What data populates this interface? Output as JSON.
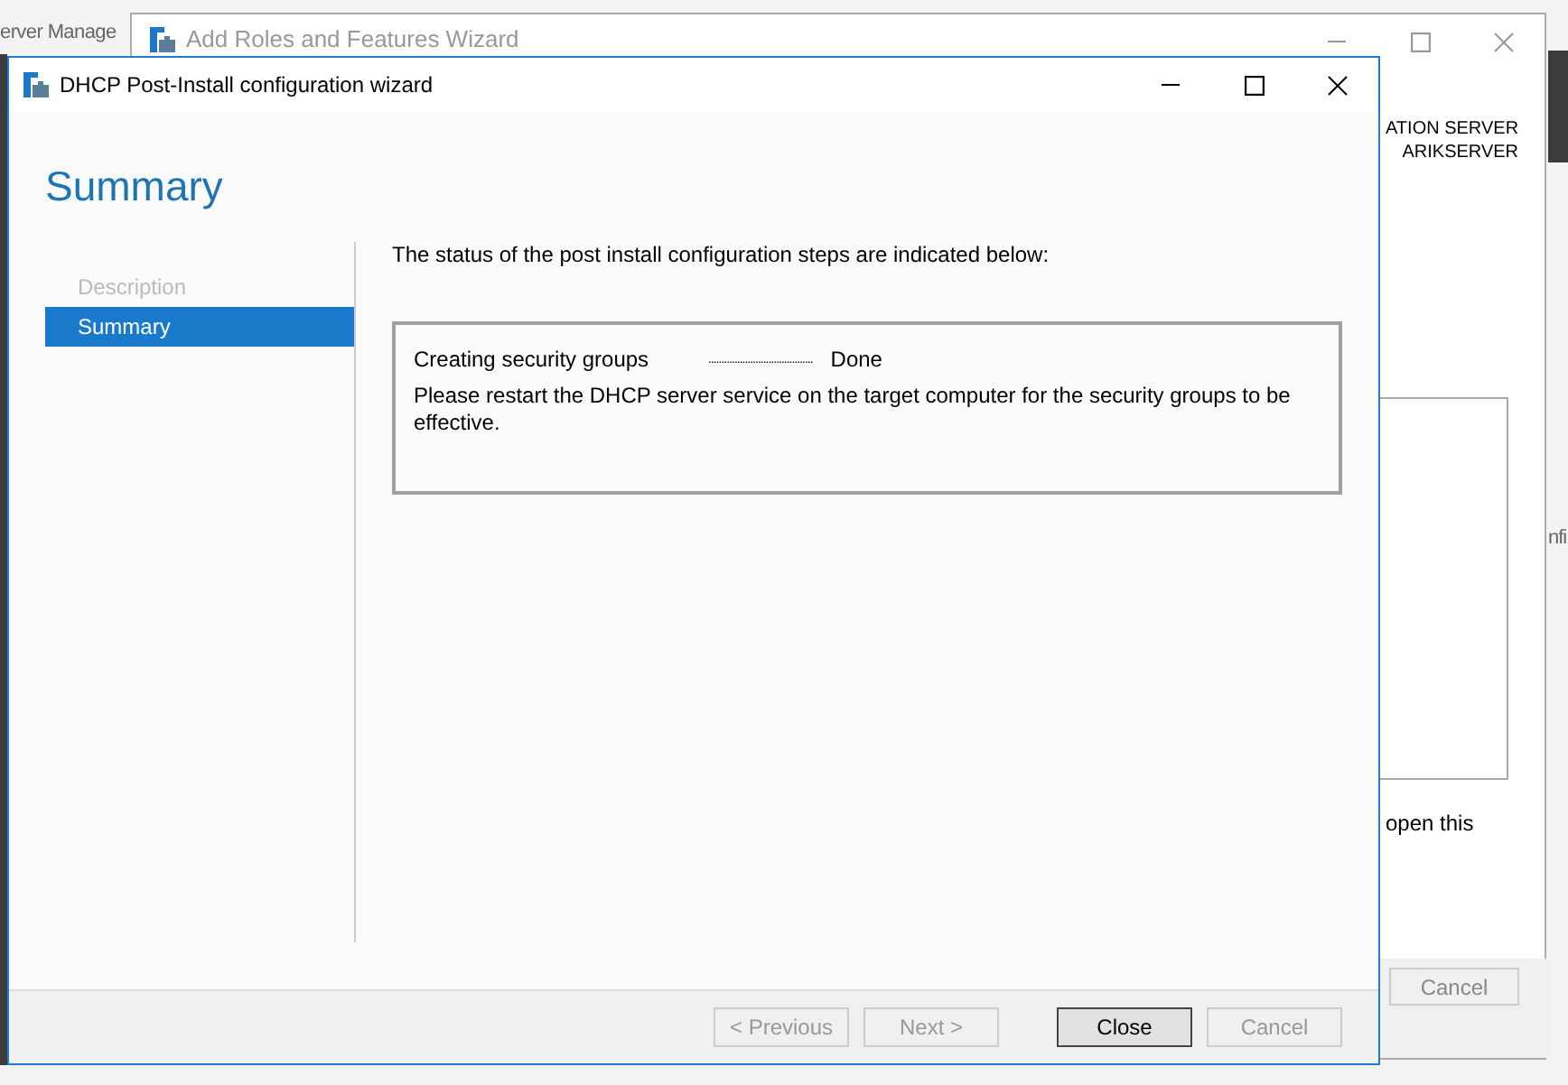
{
  "background_windows": {
    "server_manager": {
      "title": "erver Manage"
    },
    "add_roles_wizard": {
      "title": "Add Roles and Features Wizard",
      "server_lines": [
        "ATION SERVER",
        "ARIKSERVER"
      ],
      "side_text": "nfi",
      "body_text": "open this",
      "cancel_button": "Cancel"
    }
  },
  "window": {
    "title": "DHCP Post-Install configuration wizard"
  },
  "heading": "Summary",
  "nav": [
    {
      "label": "Description",
      "selected": false,
      "disabled": true
    },
    {
      "label": "Summary",
      "selected": true,
      "disabled": false
    }
  ],
  "intro": "The status of the post install configuration steps are indicated below:",
  "steps": [
    {
      "name": "Creating security groups",
      "leader": "........................................",
      "status": "Done"
    }
  ],
  "message": "Please restart the DHCP server service on the target computer for the security groups to be effective.",
  "buttons": [
    {
      "label": "< Previous",
      "disabled": true,
      "default": false
    },
    {
      "label": "Next >",
      "disabled": true,
      "default": false
    },
    {
      "label": "Close",
      "disabled": false,
      "default": true
    },
    {
      "label": "Cancel",
      "disabled": true,
      "default": false
    }
  ]
}
